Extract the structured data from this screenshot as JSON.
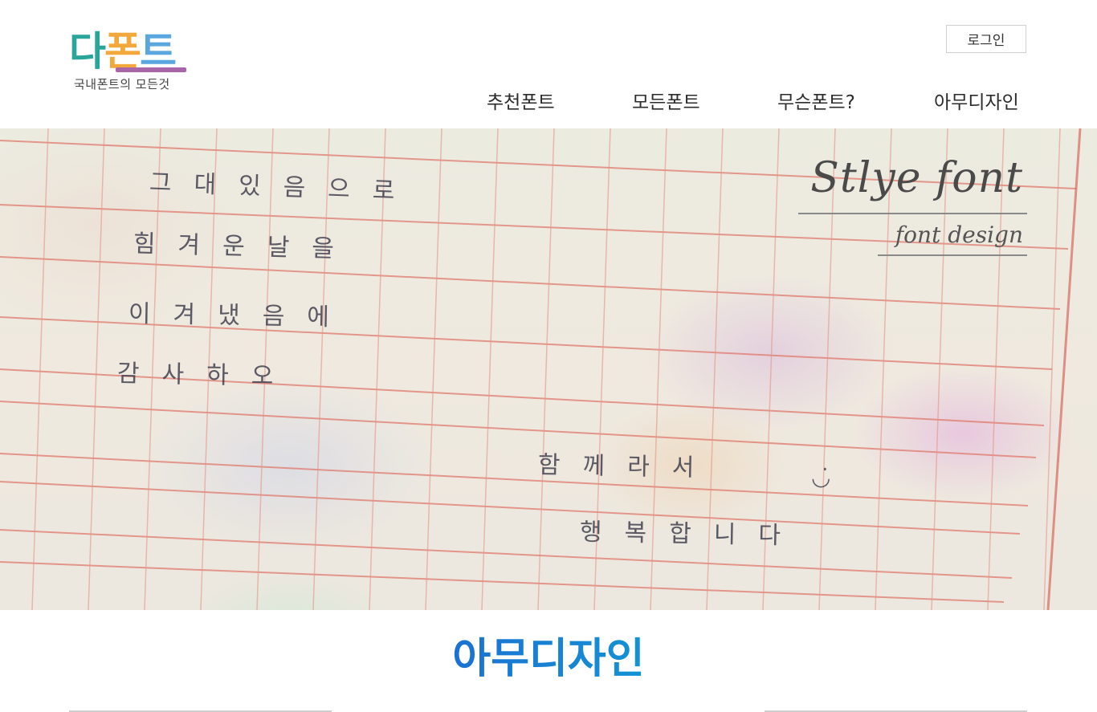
{
  "header": {
    "logo": {
      "part1": "다",
      "part2": "폰",
      "part3": "트",
      "tagline": "국내폰트의 모든것",
      "colors": {
        "part1": "#2aa59a",
        "part2": "#f2a83b",
        "part3": "#5aa6de",
        "underline": "#a865a8"
      }
    },
    "login_label": "로그인",
    "nav": [
      "추천폰트",
      "모든폰트",
      "무슨폰트?",
      "아무디자인"
    ]
  },
  "hero": {
    "handwriting": [
      "그대있음으로",
      "힘겨운날을",
      "이겨냈음에",
      "감사하오",
      "함께라서",
      "행복합니다"
    ],
    "smile": "◡̇",
    "title": "Stlye font",
    "subtitle": "font design"
  },
  "section": {
    "title": "아무디자인",
    "gradient": [
      "#1f3fc4",
      "#11c4b4"
    ]
  }
}
